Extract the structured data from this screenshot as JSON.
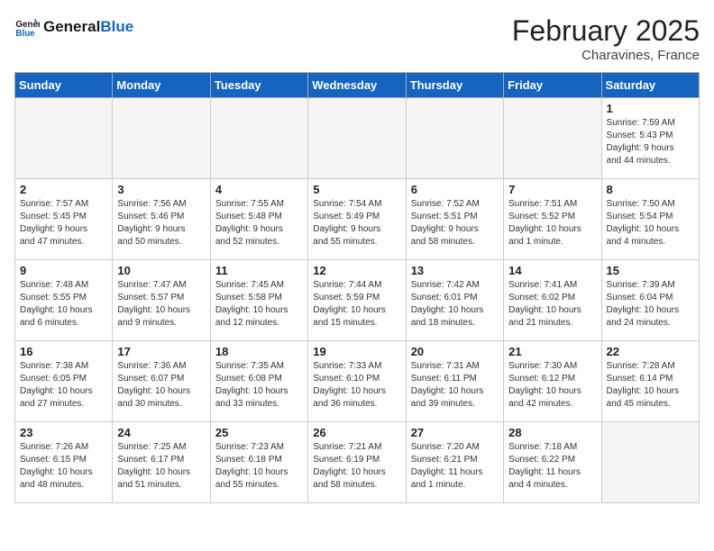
{
  "logo": {
    "text_general": "General",
    "text_blue": "Blue"
  },
  "header": {
    "month_year": "February 2025",
    "location": "Charavines, France"
  },
  "days_of_week": [
    "Sunday",
    "Monday",
    "Tuesday",
    "Wednesday",
    "Thursday",
    "Friday",
    "Saturday"
  ],
  "weeks": [
    [
      {
        "day": "",
        "info": ""
      },
      {
        "day": "",
        "info": ""
      },
      {
        "day": "",
        "info": ""
      },
      {
        "day": "",
        "info": ""
      },
      {
        "day": "",
        "info": ""
      },
      {
        "day": "",
        "info": ""
      },
      {
        "day": "1",
        "info": "Sunrise: 7:59 AM\nSunset: 5:43 PM\nDaylight: 9 hours\nand 44 minutes."
      }
    ],
    [
      {
        "day": "2",
        "info": "Sunrise: 7:57 AM\nSunset: 5:45 PM\nDaylight: 9 hours\nand 47 minutes."
      },
      {
        "day": "3",
        "info": "Sunrise: 7:56 AM\nSunset: 5:46 PM\nDaylight: 9 hours\nand 50 minutes."
      },
      {
        "day": "4",
        "info": "Sunrise: 7:55 AM\nSunset: 5:48 PM\nDaylight: 9 hours\nand 52 minutes."
      },
      {
        "day": "5",
        "info": "Sunrise: 7:54 AM\nSunset: 5:49 PM\nDaylight: 9 hours\nand 55 minutes."
      },
      {
        "day": "6",
        "info": "Sunrise: 7:52 AM\nSunset: 5:51 PM\nDaylight: 9 hours\nand 58 minutes."
      },
      {
        "day": "7",
        "info": "Sunrise: 7:51 AM\nSunset: 5:52 PM\nDaylight: 10 hours\nand 1 minute."
      },
      {
        "day": "8",
        "info": "Sunrise: 7:50 AM\nSunset: 5:54 PM\nDaylight: 10 hours\nand 4 minutes."
      }
    ],
    [
      {
        "day": "9",
        "info": "Sunrise: 7:48 AM\nSunset: 5:55 PM\nDaylight: 10 hours\nand 6 minutes."
      },
      {
        "day": "10",
        "info": "Sunrise: 7:47 AM\nSunset: 5:57 PM\nDaylight: 10 hours\nand 9 minutes."
      },
      {
        "day": "11",
        "info": "Sunrise: 7:45 AM\nSunset: 5:58 PM\nDaylight: 10 hours\nand 12 minutes."
      },
      {
        "day": "12",
        "info": "Sunrise: 7:44 AM\nSunset: 5:59 PM\nDaylight: 10 hours\nand 15 minutes."
      },
      {
        "day": "13",
        "info": "Sunrise: 7:42 AM\nSunset: 6:01 PM\nDaylight: 10 hours\nand 18 minutes."
      },
      {
        "day": "14",
        "info": "Sunrise: 7:41 AM\nSunset: 6:02 PM\nDaylight: 10 hours\nand 21 minutes."
      },
      {
        "day": "15",
        "info": "Sunrise: 7:39 AM\nSunset: 6:04 PM\nDaylight: 10 hours\nand 24 minutes."
      }
    ],
    [
      {
        "day": "16",
        "info": "Sunrise: 7:38 AM\nSunset: 6:05 PM\nDaylight: 10 hours\nand 27 minutes."
      },
      {
        "day": "17",
        "info": "Sunrise: 7:36 AM\nSunset: 6:07 PM\nDaylight: 10 hours\nand 30 minutes."
      },
      {
        "day": "18",
        "info": "Sunrise: 7:35 AM\nSunset: 6:08 PM\nDaylight: 10 hours\nand 33 minutes."
      },
      {
        "day": "19",
        "info": "Sunrise: 7:33 AM\nSunset: 6:10 PM\nDaylight: 10 hours\nand 36 minutes."
      },
      {
        "day": "20",
        "info": "Sunrise: 7:31 AM\nSunset: 6:11 PM\nDaylight: 10 hours\nand 39 minutes."
      },
      {
        "day": "21",
        "info": "Sunrise: 7:30 AM\nSunset: 6:12 PM\nDaylight: 10 hours\nand 42 minutes."
      },
      {
        "day": "22",
        "info": "Sunrise: 7:28 AM\nSunset: 6:14 PM\nDaylight: 10 hours\nand 45 minutes."
      }
    ],
    [
      {
        "day": "23",
        "info": "Sunrise: 7:26 AM\nSunset: 6:15 PM\nDaylight: 10 hours\nand 48 minutes."
      },
      {
        "day": "24",
        "info": "Sunrise: 7:25 AM\nSunset: 6:17 PM\nDaylight: 10 hours\nand 51 minutes."
      },
      {
        "day": "25",
        "info": "Sunrise: 7:23 AM\nSunset: 6:18 PM\nDaylight: 10 hours\nand 55 minutes."
      },
      {
        "day": "26",
        "info": "Sunrise: 7:21 AM\nSunset: 6:19 PM\nDaylight: 10 hours\nand 58 minutes."
      },
      {
        "day": "27",
        "info": "Sunrise: 7:20 AM\nSunset: 6:21 PM\nDaylight: 11 hours\nand 1 minute."
      },
      {
        "day": "28",
        "info": "Sunrise: 7:18 AM\nSunset: 6:22 PM\nDaylight: 11 hours\nand 4 minutes."
      },
      {
        "day": "",
        "info": ""
      }
    ]
  ]
}
